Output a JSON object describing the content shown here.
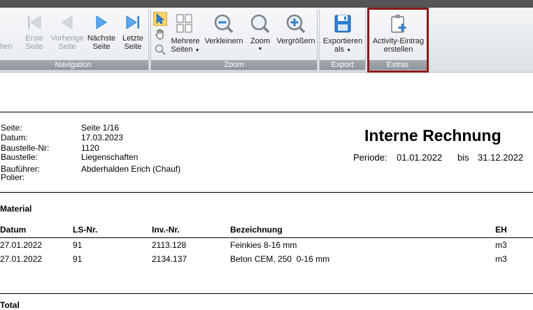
{
  "toolbar": {
    "nav_prev_partial": "hen",
    "first_page": [
      "Erste",
      "Seite"
    ],
    "prev_page": [
      "Vorherige",
      "Seite"
    ],
    "next_page": [
      "Nächste",
      "Seite"
    ],
    "last_page": [
      "Letzte",
      "Seite"
    ],
    "multiple_pages": [
      "Mehrere",
      "Seiten"
    ],
    "zoom_out": "Verkleinern",
    "zoom": "Zoom",
    "zoom_in": "Vergrößern",
    "export": [
      "Exportieren",
      "als"
    ],
    "activity": [
      "Activity-Eintrag",
      "erstellen"
    ],
    "groups": {
      "navigation": "Navigation",
      "zoom": "Zoom",
      "export": "Export",
      "extras": "Extras"
    }
  },
  "report": {
    "meta_labels": [
      "Seite:",
      "Datum:",
      "Baustelle-Nr:",
      "Baustelle:",
      "Bauführer:",
      "Polier:"
    ],
    "meta_values": [
      "Seite 1/16",
      "17.03.2023",
      "1120",
      "Liegenschaften",
      "Abderhalden Erich (Chauf)",
      ""
    ],
    "title": "Interne Rechnung",
    "period_label": "Periode:",
    "period_from": "01.01.2022",
    "period_bis": "bis",
    "period_to": "31.12.2022",
    "section_material": "Material",
    "columns": [
      "Datum",
      "LS-Nr.",
      "Inv.-Nr.",
      "Bezeichnung",
      "EH"
    ],
    "rows": [
      [
        "27.01.2022",
        "91",
        "2113.128",
        "Feinkies 8-16 mm",
        "m3"
      ],
      [
        "27.01.2022",
        "91",
        "2134.137",
        "Beton CEM, 250  0-16 mm",
        "m3"
      ]
    ],
    "section_total": "Total"
  },
  "colors": {
    "highlight": "#8b1a1a",
    "nav_blue": "#3a8ee6"
  }
}
